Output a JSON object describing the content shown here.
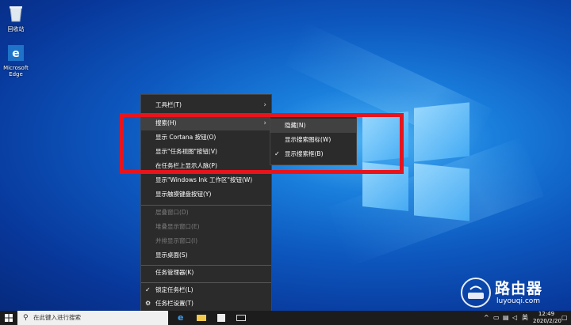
{
  "desktop": {
    "icons": [
      {
        "name": "recycle-bin",
        "label": "回收站"
      },
      {
        "name": "edge",
        "label": "Microsoft\nEdge"
      }
    ]
  },
  "context_menu": {
    "items": [
      {
        "label": "工具栏(T)",
        "submenu": true
      },
      {
        "label": "搜索(H)",
        "submenu": true,
        "highlighted": true
      },
      {
        "label": "显示 Cortana 按钮(O)"
      },
      {
        "label": "显示\"任务视图\"按钮(V)"
      },
      {
        "label": "在任务栏上显示人脉(P)"
      },
      {
        "label": "显示\"Windows Ink 工作区\"按钮(W)"
      },
      {
        "label": "显示触摸键盘按钮(Y)"
      },
      {
        "label": "层叠窗口(D)",
        "disabled": true
      },
      {
        "label": "堆叠显示窗口(E)",
        "disabled": true
      },
      {
        "label": "并排显示窗口(I)",
        "disabled": true
      },
      {
        "label": "显示桌面(S)"
      },
      {
        "label": "任务管理器(K)"
      },
      {
        "label": "锁定任务栏(L)",
        "checked": true
      },
      {
        "label": "任务栏设置(T)",
        "icon": "gear-icon"
      }
    ]
  },
  "search_submenu": {
    "items": [
      {
        "label": "隐藏(N)",
        "highlighted": true
      },
      {
        "label": "显示搜索图标(W)"
      },
      {
        "label": "显示搜索框(B)",
        "checked": true
      }
    ]
  },
  "taskbar": {
    "search_placeholder": "在此键入进行搜索",
    "language": "英",
    "time": "12:49",
    "date": "2020/2/20"
  },
  "watermark": {
    "title": "路由器",
    "url": "luyouqi.com"
  },
  "colors": {
    "highlight_box": "#e8141c",
    "menu_bg": "#2b2b2b"
  }
}
